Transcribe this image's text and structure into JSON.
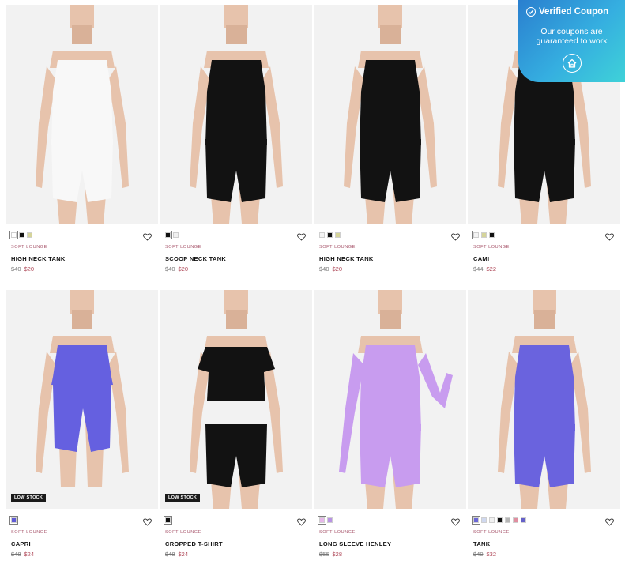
{
  "coupon": {
    "title": "Verified Coupon",
    "subtitle_line1": "Our coupons are",
    "subtitle_line2": "guaranteed to work",
    "icon": "home-icon"
  },
  "colors": {
    "sale_price": "#b04a5a",
    "collection": "#a7546a",
    "coupon_gradient_start": "#2a7fcf",
    "coupon_gradient_end": "#3fd2d8",
    "low_stock_badge": "#1b1b1b"
  },
  "products": [
    {
      "collection": "SOFT LOUNGE",
      "name": "HIGH NECK TANK",
      "old_price": "$40",
      "new_price": "$20",
      "swatches": [
        "#ffffff",
        "#111111",
        "#d5d49a"
      ],
      "badge": "",
      "top_color": "#f8f8f8",
      "bottom_color": "#f8f8f8"
    },
    {
      "collection": "SOFT LOUNGE",
      "name": "SCOOP NECK TANK",
      "old_price": "$40",
      "new_price": "$20",
      "swatches": [
        "#111111",
        "#f1f1f1"
      ],
      "badge": "",
      "top_color": "#121212",
      "bottom_color": "#121212"
    },
    {
      "collection": "SOFT LOUNGE",
      "name": "HIGH NECK TANK",
      "old_price": "$40",
      "new_price": "$20",
      "swatches": [
        "#f4f4f4",
        "#111111",
        "#d5d49a"
      ],
      "badge": "",
      "top_color": "#121212",
      "bottom_color": "#121212"
    },
    {
      "collection": "SOFT LOUNGE",
      "name": "CAMI",
      "old_price": "$44",
      "new_price": "$22",
      "swatches": [
        "#f4f4f4",
        "#d5d49a",
        "#111111"
      ],
      "badge": "",
      "top_color": "#121212",
      "bottom_color": "#121212"
    },
    {
      "collection": "SOFT LOUNGE",
      "name": "CAPRI",
      "old_price": "$48",
      "new_price": "$24",
      "swatches": [
        "#5f5ad6"
      ],
      "badge": "LOW STOCK",
      "top_color": "#6560e0",
      "bottom_color": "#6560e0"
    },
    {
      "collection": "SOFT LOUNGE",
      "name": "CROPPED T-SHIRT",
      "old_price": "$48",
      "new_price": "$24",
      "swatches": [
        "#111111"
      ],
      "badge": "LOW STOCK",
      "top_color": "#121212",
      "bottom_color": "#121212"
    },
    {
      "collection": "SOFT LOUNGE",
      "name": "LONG SLEEVE HENLEY",
      "old_price": "$56",
      "new_price": "$28",
      "swatches": [
        "#e7b7ea",
        "#b892e4"
      ],
      "badge": "",
      "top_color": "#c89cef",
      "bottom_color": "#c89cef"
    },
    {
      "collection": "SOFT LOUNGE",
      "name": "TANK",
      "old_price": "$40",
      "new_price": "$32",
      "swatches": [
        "#6b67d6",
        "#cfd8ef",
        "#f1f1f1",
        "#111111",
        "#b5b5b5",
        "#e08ea0",
        "#6560c8"
      ],
      "badge": "",
      "top_color": "#6a63de",
      "bottom_color": "#6a63de"
    }
  ]
}
